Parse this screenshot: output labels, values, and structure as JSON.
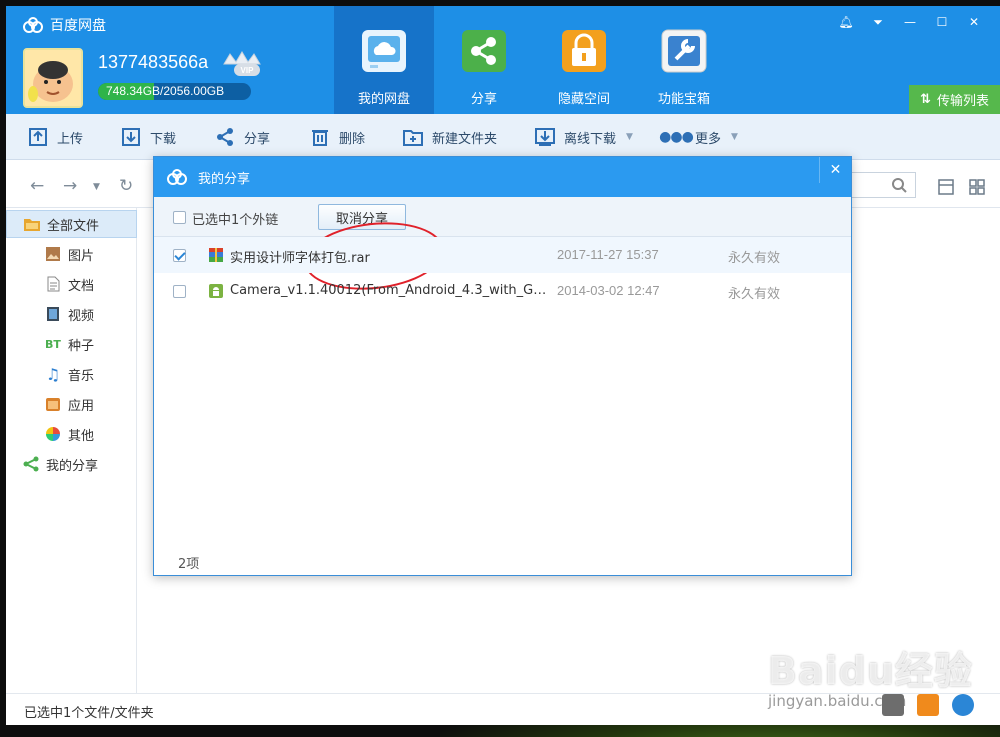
{
  "app": {
    "title": "百度网盘"
  },
  "user": {
    "name": "1377483566a",
    "vip_badge": "VIP",
    "quota": "748.34GB/2056.00GB",
    "quota_fraction": 0.364
  },
  "nav_tabs": [
    {
      "label": "我的网盘",
      "icon": "cloud-disk-icon",
      "active": true
    },
    {
      "label": "分享",
      "icon": "share-icon",
      "active": false
    },
    {
      "label": "隐藏空间",
      "icon": "lock-icon",
      "active": false
    },
    {
      "label": "功能宝箱",
      "icon": "toolbox-icon",
      "active": false
    }
  ],
  "window_controls": [
    "bell-icon",
    "dropdown-icon",
    "minimize-icon",
    "maximize-icon",
    "close-icon"
  ],
  "transfer_list": {
    "label": "传输列表"
  },
  "toolbar": {
    "upload": "上传",
    "download": "下载",
    "share": "分享",
    "delete": "删除",
    "new_folder": "新建文件夹",
    "offline_download": "离线下载",
    "more": "更多"
  },
  "sidebar": {
    "items": [
      {
        "label": "全部文件",
        "icon": "all-files-icon"
      },
      {
        "label": "图片",
        "icon": "image-icon"
      },
      {
        "label": "文档",
        "icon": "document-icon"
      },
      {
        "label": "视频",
        "icon": "video-icon"
      },
      {
        "label": "种子",
        "icon": "bt-icon",
        "icon_text": "BT"
      },
      {
        "label": "音乐",
        "icon": "music-icon"
      },
      {
        "label": "应用",
        "icon": "app-icon"
      },
      {
        "label": "其他",
        "icon": "other-icon"
      },
      {
        "label": "我的分享",
        "icon": "share-icon"
      }
    ]
  },
  "status": {
    "text": "已选中1个文件/文件夹"
  },
  "dialog": {
    "title": "我的分享",
    "selected_label": "已选中1个外链",
    "cancel_share": "取消分享",
    "rows": [
      {
        "name": "实用设计师字体打包.rar",
        "date": "2017-11-27 15:37",
        "validity": "永久有效",
        "checked": true,
        "icon": "rar-file-icon"
      },
      {
        "name": "Camera_v1.1.40012(From_Android_4.3_with_Galle...",
        "date": "2014-03-02 12:47",
        "validity": "永久有效",
        "checked": false,
        "icon": "android-apk-icon"
      }
    ],
    "count": "2项"
  },
  "watermark": {
    "big": "Baidu经验",
    "small": "jingyan.baidu.com"
  },
  "colors": {
    "header_blue": "#1e8fe6",
    "active_tab": "#1673c9",
    "transfer_green": "#56b84c",
    "dialog_blue": "#2b9af0",
    "annotation_red": "#e0212a"
  }
}
